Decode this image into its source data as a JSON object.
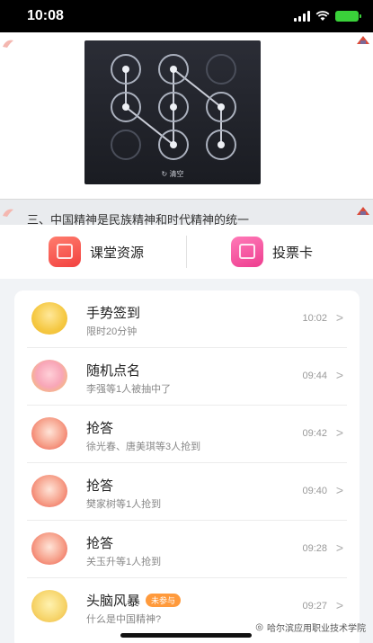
{
  "status_bar": {
    "time": "10:08"
  },
  "slide": {
    "gesture_clear_label": "清空",
    "caption": "三、中国精神是民族精神和时代精神的统一"
  },
  "resources": [
    {
      "label": "课堂资源",
      "icon": "classroom-resources-icon"
    },
    {
      "label": "投票卡",
      "icon": "ticket-icon"
    }
  ],
  "activities": [
    {
      "title": "手势签到",
      "subtitle": "限时20分钟",
      "time": "10:02",
      "icon": "location-pin-icon"
    },
    {
      "title": "随机点名",
      "subtitle": "李强等1人被抽中了",
      "time": "09:44",
      "icon": "gumball-machine-icon"
    },
    {
      "title": "抢答",
      "subtitle": "徐光春、唐美琪等3人抢到",
      "time": "09:42",
      "icon": "raise-hand-clock-icon"
    },
    {
      "title": "抢答",
      "subtitle": "樊家树等1人抢到",
      "time": "09:40",
      "icon": "raise-hand-clock-icon"
    },
    {
      "title": "抢答",
      "subtitle": "关玉升等1人抢到",
      "time": "09:28",
      "icon": "raise-hand-clock-icon"
    },
    {
      "title": "头脑风暴",
      "badge": "未参与",
      "subtitle": "什么是中国精神?",
      "time": "09:27",
      "icon": "lightbulb-icon"
    }
  ],
  "watermark": "哈尔滨应用职业技术学院"
}
